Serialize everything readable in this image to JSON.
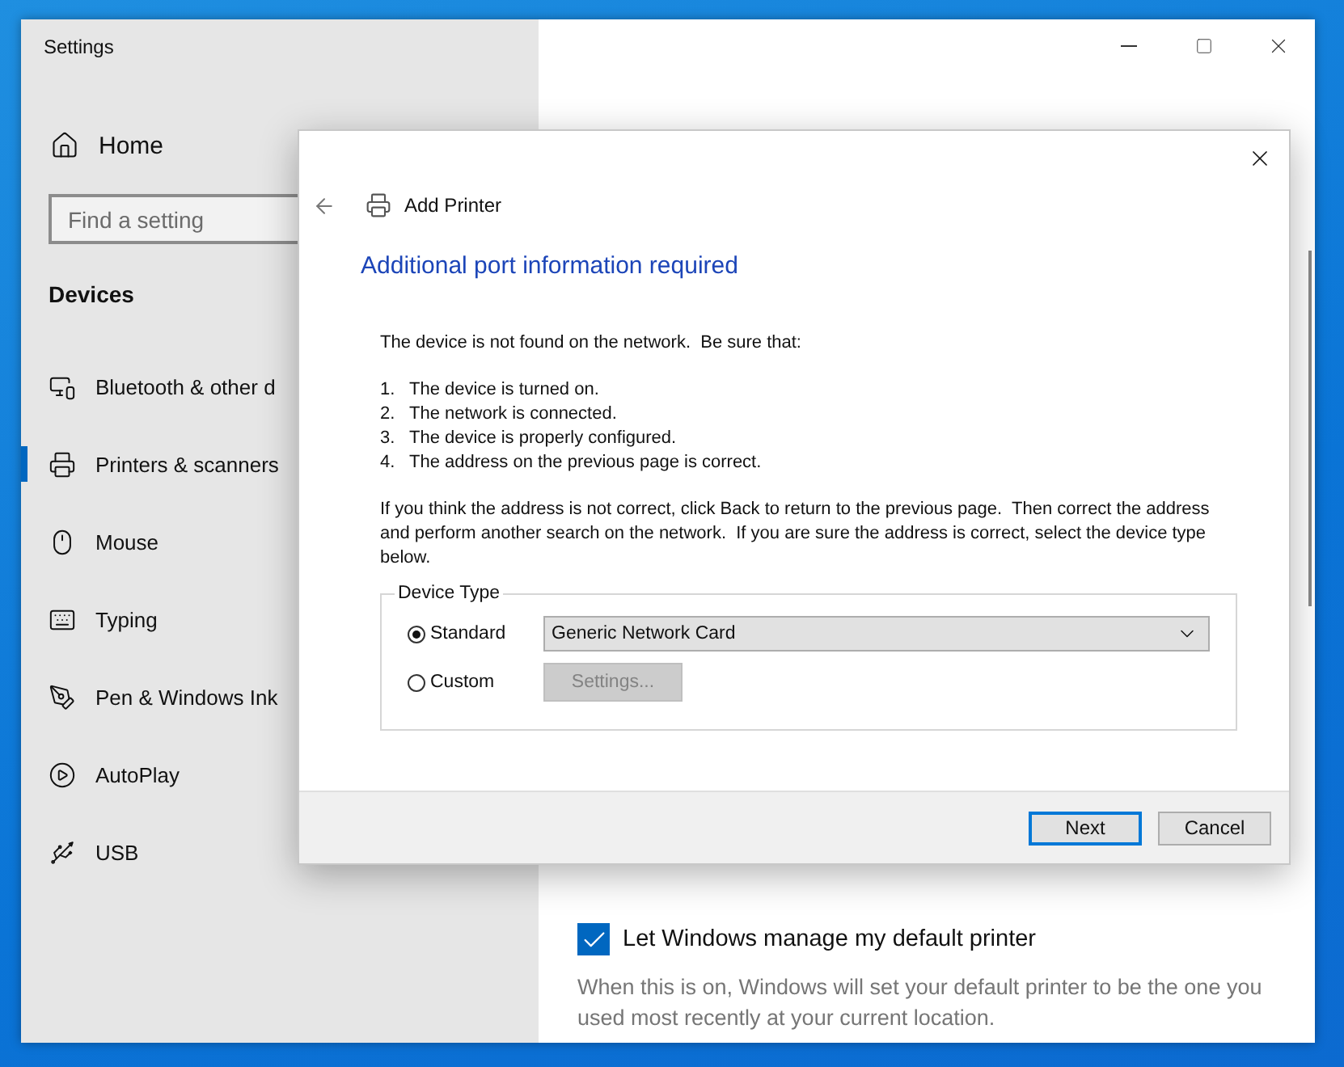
{
  "settings_window": {
    "title": "Settings"
  },
  "sidebar": {
    "home": "Home",
    "search": {
      "placeholder": "Find a setting"
    },
    "section": "Devices",
    "items": [
      {
        "label": "Bluetooth & other d",
        "selected": false
      },
      {
        "label": "Printers & scanners",
        "selected": true
      },
      {
        "label": "Mouse",
        "selected": false
      },
      {
        "label": "Typing",
        "selected": false
      },
      {
        "label": "Pen & Windows Ink",
        "selected": false
      },
      {
        "label": "AutoPlay",
        "selected": false
      },
      {
        "label": "USB",
        "selected": false
      }
    ]
  },
  "content": {
    "default_printer": {
      "label": "Let Windows manage my default printer",
      "checked": true
    },
    "description": "When this is on, Windows will set your default printer to be the one you used most recently at your current location."
  },
  "dialog": {
    "title": "Add Printer",
    "heading": "Additional port information required",
    "intro": "The device is not found on the network.  Be sure that:",
    "steps": [
      {
        "number": "1.",
        "text": "The device is turned on."
      },
      {
        "number": "2.",
        "text": "The network is connected."
      },
      {
        "number": "3.",
        "text": "The device is properly configured."
      },
      {
        "number": "4.",
        "text": "The address on the previous page is correct."
      }
    ],
    "note": "If you think the address is not correct, click Back to return to the previous page.  Then correct the address and perform another search on the network.  If you are sure the address is correct, select the device type below.",
    "device_type": {
      "legend": "Device Type",
      "options": [
        {
          "label": "Standard",
          "selected": true
        },
        {
          "label": "Custom",
          "selected": false
        }
      ],
      "dropdown": {
        "value": "Generic Network Card"
      },
      "settings_button": {
        "label": "Settings...",
        "disabled": true
      }
    },
    "buttons": [
      {
        "label": "Next",
        "default": true
      },
      {
        "label": "Cancel",
        "default": false
      }
    ]
  }
}
